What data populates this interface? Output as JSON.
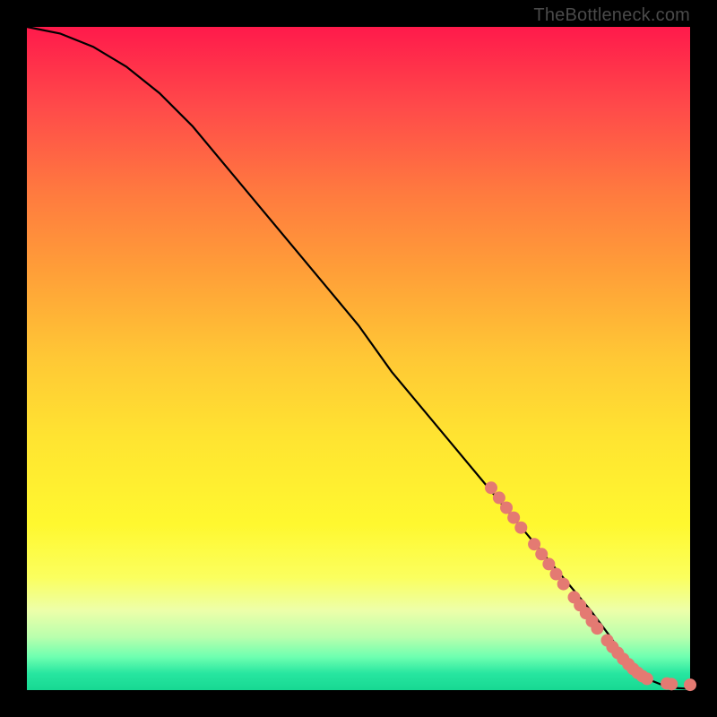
{
  "attribution": "TheBottleneck.com",
  "chart_data": {
    "type": "line",
    "title": "",
    "xlabel": "",
    "ylabel": "",
    "xlim": [
      0,
      100
    ],
    "ylim": [
      0,
      100
    ],
    "background_gradient": {
      "direction": "vertical",
      "stops": [
        {
          "pos": 0.0,
          "color": "#ff1a4b"
        },
        {
          "pos": 0.5,
          "color": "#ffe431"
        },
        {
          "pos": 0.95,
          "color": "#6effb0"
        },
        {
          "pos": 1.0,
          "color": "#17d892"
        }
      ]
    },
    "series": [
      {
        "name": "bottleneck-curve",
        "x": [
          0,
          5,
          10,
          15,
          20,
          25,
          30,
          35,
          40,
          45,
          50,
          55,
          60,
          65,
          70,
          75,
          80,
          85,
          88,
          90,
          92,
          94,
          96,
          98,
          100
        ],
        "y": [
          100,
          99,
          97,
          94,
          90,
          85,
          79,
          73,
          67,
          61,
          55,
          48,
          42,
          36,
          30,
          24,
          18,
          12,
          8,
          5,
          3,
          1.5,
          0.7,
          0.3,
          0.2
        ]
      }
    ],
    "markers": [
      {
        "x": 70.0,
        "y": 30.5
      },
      {
        "x": 71.2,
        "y": 29.0
      },
      {
        "x": 72.3,
        "y": 27.5
      },
      {
        "x": 73.4,
        "y": 26.0
      },
      {
        "x": 74.5,
        "y": 24.5
      },
      {
        "x": 76.5,
        "y": 22.0
      },
      {
        "x": 77.6,
        "y": 20.5
      },
      {
        "x": 78.7,
        "y": 19.0
      },
      {
        "x": 79.8,
        "y": 17.5
      },
      {
        "x": 80.9,
        "y": 16.0
      },
      {
        "x": 82.5,
        "y": 14.0
      },
      {
        "x": 83.4,
        "y": 12.8
      },
      {
        "x": 84.3,
        "y": 11.6
      },
      {
        "x": 85.2,
        "y": 10.4
      },
      {
        "x": 86.0,
        "y": 9.3
      },
      {
        "x": 87.5,
        "y": 7.5
      },
      {
        "x": 88.3,
        "y": 6.5
      },
      {
        "x": 89.1,
        "y": 5.6
      },
      {
        "x": 89.9,
        "y": 4.7
      },
      {
        "x": 90.7,
        "y": 3.9
      },
      {
        "x": 91.4,
        "y": 3.2
      },
      {
        "x": 92.1,
        "y": 2.6
      },
      {
        "x": 92.8,
        "y": 2.1
      },
      {
        "x": 93.5,
        "y": 1.7
      },
      {
        "x": 96.5,
        "y": 1.0
      },
      {
        "x": 97.2,
        "y": 0.9
      },
      {
        "x": 100.0,
        "y": 0.8
      }
    ],
    "marker_style": {
      "shape": "circle",
      "radius_px": 7,
      "color": "#e47a72"
    }
  }
}
